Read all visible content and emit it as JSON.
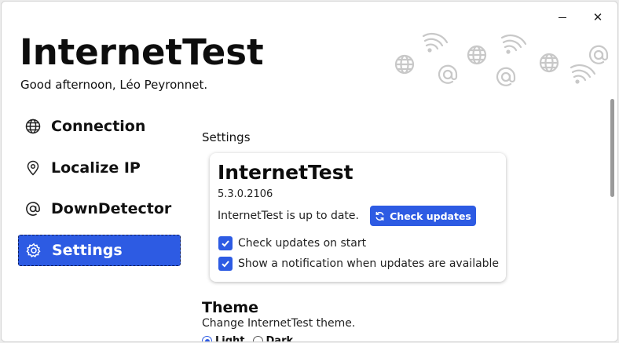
{
  "window": {
    "minimize_icon": "minimize-icon",
    "close_glyph": "✕"
  },
  "header": {
    "title": "InternetTest",
    "greeting": "Good afternoon, Léo Peyronnet."
  },
  "sidebar": {
    "items": [
      {
        "label": "Connection",
        "icon": "globe-icon"
      },
      {
        "label": "Localize IP",
        "icon": "map-pin-icon"
      },
      {
        "label": "DownDetector",
        "icon": "at-sign-icon"
      },
      {
        "label": "Settings",
        "icon": "gear-icon",
        "active": true
      }
    ]
  },
  "main": {
    "heading": "Settings",
    "card": {
      "title": "InternetTest",
      "version": "5.3.0.2106",
      "status": "InternetTest is up to date.",
      "check_button": "Check updates",
      "options": [
        {
          "label": "Check updates on start",
          "checked": true
        },
        {
          "label": "Show a notification when updates are available",
          "checked": true
        }
      ]
    },
    "theme": {
      "title": "Theme",
      "description": "Change InternetTest theme.",
      "options": [
        {
          "label": "Light",
          "selected": true
        },
        {
          "label": "Dark",
          "selected": false
        }
      ]
    }
  },
  "colors": {
    "accent": "#2d5be3",
    "decoration": "#c8c8c8"
  }
}
